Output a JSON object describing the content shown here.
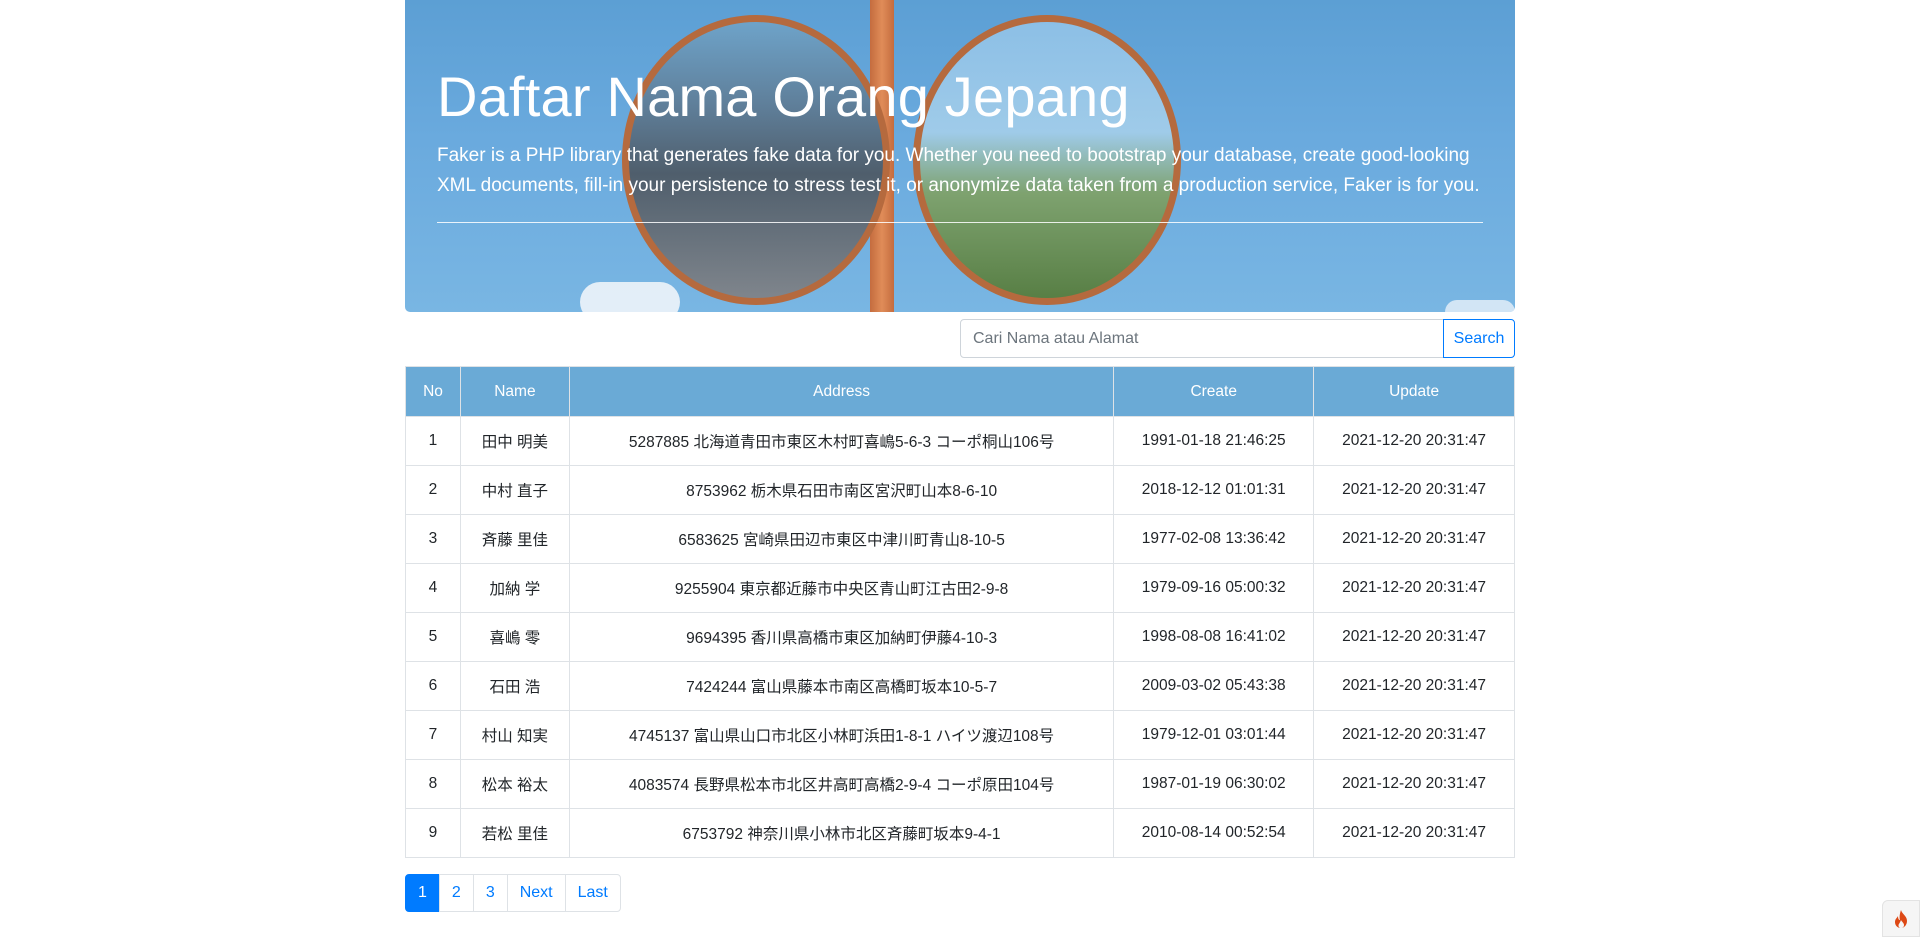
{
  "hero": {
    "title": "Daftar Nama Orang Jepang",
    "description": "Faker is a PHP library that generates fake data for you. Whether you need to bootstrap your database, create good-looking XML documents, fill-in your persistence to stress test it, or anonymize data taken from a production service, Faker is for you."
  },
  "search": {
    "placeholder": "Cari Nama atau Alamat",
    "value": "",
    "button_label": "Search"
  },
  "table": {
    "headers": [
      "No",
      "Name",
      "Address",
      "Create",
      "Update"
    ],
    "rows": [
      [
        "1",
        "田中 明美",
        "5287885 北海道青田市東区木村町喜嶋5-6-3 コーポ桐山106号",
        "1991-01-18 21:46:25",
        "2021-12-20 20:31:47"
      ],
      [
        "2",
        "中村 直子",
        "8753962 栃木県石田市南区宮沢町山本8-6-10",
        "2018-12-12 01:01:31",
        "2021-12-20 20:31:47"
      ],
      [
        "3",
        "斉藤 里佳",
        "6583625 宮崎県田辺市東区中津川町青山8-10-5",
        "1977-02-08 13:36:42",
        "2021-12-20 20:31:47"
      ],
      [
        "4",
        "加納 学",
        "9255904 東京都近藤市中央区青山町江古田2-9-8",
        "1979-09-16 05:00:32",
        "2021-12-20 20:31:47"
      ],
      [
        "5",
        "喜嶋 零",
        "9694395 香川県高橋市東区加納町伊藤4-10-3",
        "1998-08-08 16:41:02",
        "2021-12-20 20:31:47"
      ],
      [
        "6",
        "石田 浩",
        "7424244 富山県藤本市南区高橋町坂本10-5-7",
        "2009-03-02 05:43:38",
        "2021-12-20 20:31:47"
      ],
      [
        "7",
        "村山 知実",
        "4745137 富山県山口市北区小林町浜田1-8-1 ハイツ渡辺108号",
        "1979-12-01 03:01:44",
        "2021-12-20 20:31:47"
      ],
      [
        "8",
        "松本 裕太",
        "4083574 長野県松本市北区井高町高橋2-9-4 コーポ原田104号",
        "1987-01-19 06:30:02",
        "2021-12-20 20:31:47"
      ],
      [
        "9",
        "若松 里佳",
        "6753792 神奈川県小林市北区斉藤町坂本9-4-1",
        "2010-08-14 00:52:54",
        "2021-12-20 20:31:47"
      ]
    ]
  },
  "pagination": {
    "pages": [
      "1",
      "2",
      "3"
    ],
    "active_page": "1",
    "next_label": "Next",
    "last_label": "Last"
  },
  "toolbar": {
    "icon": "flame-icon"
  },
  "colors": {
    "header_bg": "#6aaad6",
    "primary": "#007bff"
  }
}
